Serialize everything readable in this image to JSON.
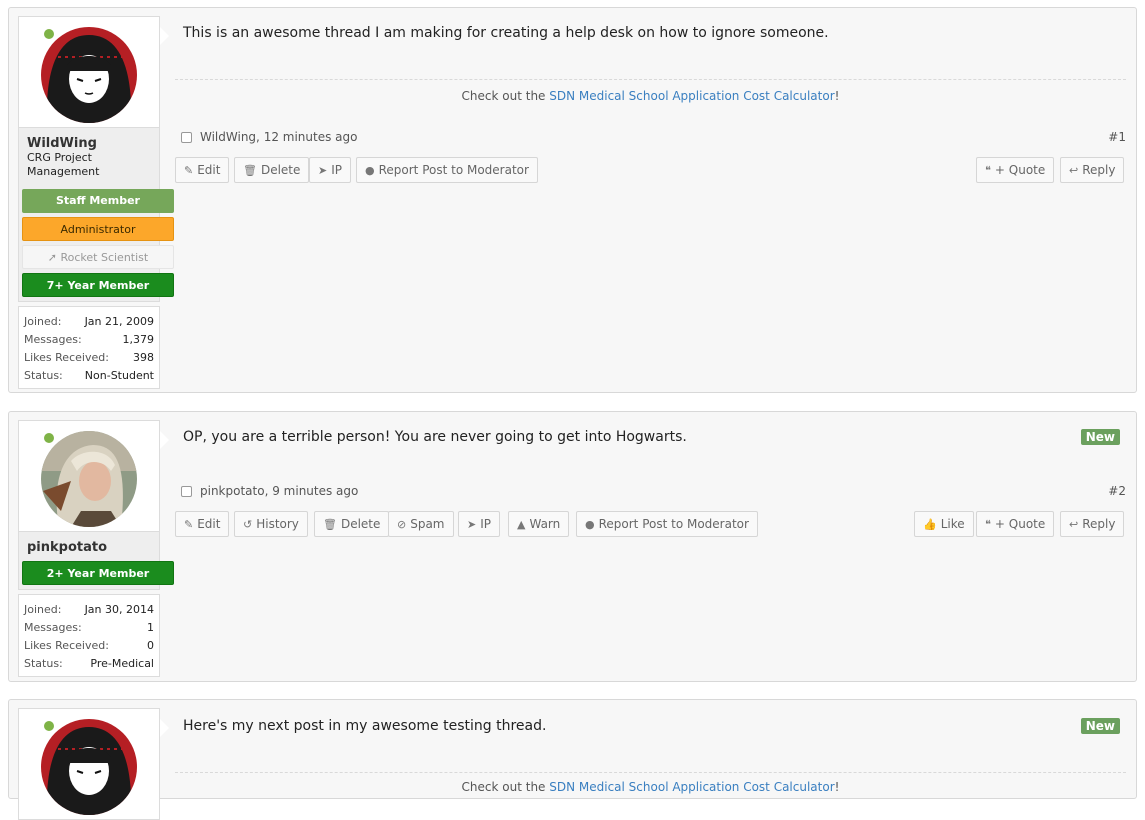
{
  "posts": [
    {
      "message": "This is an awesome thread I am making for creating a help desk on how to ignore someone.",
      "signature": {
        "prefix": "Check out the ",
        "link": "SDN Medical School Application Cost Calculator",
        "suffix": "!"
      },
      "author": "WildWing",
      "time": "12 minutes ago",
      "number": "#1",
      "user": {
        "name": "WildWing",
        "title": "CRG Project Management",
        "banners": {
          "staff": "Staff Member",
          "admin": "Administrator",
          "rocket": "Rocket Scientist",
          "years": "7+ Year Member"
        },
        "stats": [
          {
            "k": "Joined:",
            "v": "Jan 21, 2009"
          },
          {
            "k": "Messages:",
            "v": "1,379"
          },
          {
            "k": "Likes Received:",
            "v": "398"
          },
          {
            "k": "Status:",
            "v": "Non-Student"
          }
        ]
      },
      "actions": {
        "edit": "Edit",
        "delete": "Delete",
        "ip": "IP",
        "report": "Report Post to Moderator",
        "quote": "+ Quote",
        "reply": "Reply"
      }
    },
    {
      "message": "OP, you are a terrible person! You are never going to get into Hogwarts.",
      "badge": "New",
      "author": "pinkpotato",
      "time": "9 minutes ago",
      "number": "#2",
      "user": {
        "name": "pinkpotato",
        "banners": {
          "years": "2+ Year Member"
        },
        "stats": [
          {
            "k": "Joined:",
            "v": "Jan 30, 2014"
          },
          {
            "k": "Messages:",
            "v": "1"
          },
          {
            "k": "Likes Received:",
            "v": "0"
          },
          {
            "k": "Status:",
            "v": "Pre-Medical"
          }
        ]
      },
      "actions": {
        "edit": "Edit",
        "history": "History",
        "delete": "Delete",
        "spam": "Spam",
        "ip": "IP",
        "warn": "Warn",
        "report": "Report Post to Moderator",
        "like": "Like",
        "quote": "+ Quote",
        "reply": "Reply"
      }
    },
    {
      "message": "Here's my next post in my awesome testing thread.",
      "badge": "New",
      "signature": {
        "prefix": "Check out the ",
        "link": "SDN Medical School Application Cost Calculator",
        "suffix": "!"
      }
    }
  ],
  "icons": [
    "pencil-icon",
    "trash-icon",
    "send-icon",
    "alert-circle-icon",
    "quote-icon",
    "reply-icon",
    "history-icon",
    "ban-icon",
    "warning-icon",
    "thumbs-up-icon",
    "rocket-icon"
  ],
  "colors": {
    "staff": "#76a75a",
    "admin": "#fca72a",
    "year_member": "#1b8c1e",
    "new_badge": "#6ba05e",
    "link": "#3a7fc0",
    "online": "#7fb347"
  }
}
